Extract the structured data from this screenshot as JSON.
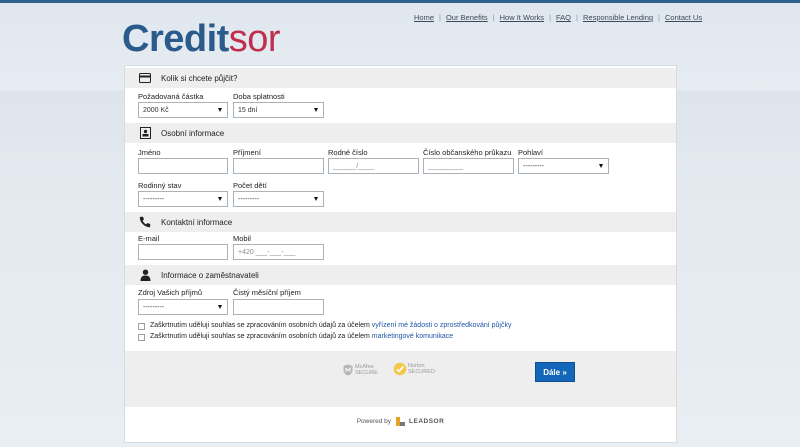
{
  "brand": {
    "part1": "Credit",
    "part2": "sor"
  },
  "nav": [
    "Home",
    "Our Benefits",
    "How It Works",
    "FAQ",
    "Responsible Lending",
    "Contact Us"
  ],
  "sections": {
    "loan": {
      "title": "Kolik si chcete půjčit?",
      "amount_label": "Požadovaná částka",
      "amount_value": "2000 Kč",
      "term_label": "Doba splatnosti",
      "term_value": "15 dní"
    },
    "personal": {
      "title": "Osobní informace",
      "first_name_label": "Jméno",
      "last_name_label": "Příjmení",
      "birth_number_label": "Rodné číslo",
      "birth_number_placeholder": "______/____",
      "id_card_label": "Číslo občanského průkazu",
      "id_card_placeholder": "_________",
      "gender_label": "Pohlaví",
      "gender_value": "---------",
      "marital_label": "Rodinný stav",
      "marital_value": "---------",
      "children_label": "Počet dětí",
      "children_value": "---------"
    },
    "contact": {
      "title": "Kontaktní informace",
      "email_label": "E-mail",
      "mobile_label": "Mobil",
      "mobile_placeholder": "+420 ___-___-___"
    },
    "employer": {
      "title": "Informace o zaměstnavateli",
      "income_source_label": "Zdroj Vašich příjmů",
      "income_source_value": "---------",
      "net_income_label": "Čistý měsíční příjem"
    }
  },
  "consents": [
    {
      "text": "Zaškrtnutím uděluji souhlas se zpracováním osobních údajů za účelem ",
      "link": "vyřízení mé žádosti o zprostředkování půjčky"
    },
    {
      "text": "Zaškrtnutím uděluji souhlas se zpracováním osobních údajů za účelem ",
      "link": "marketingové komunikace"
    }
  ],
  "badges": {
    "mcafee_line1": "McAfee",
    "mcafee_line2": "SECURE",
    "norton_line1": "Norton",
    "norton_line2": "SECURED"
  },
  "next_button": "Dále »",
  "powered": {
    "label": "Powered by",
    "brand": "LEADSOR"
  },
  "colors": {
    "accent": "#1466b8",
    "brand_blue": "#2a5b8b",
    "brand_red": "#bf2f4d"
  }
}
